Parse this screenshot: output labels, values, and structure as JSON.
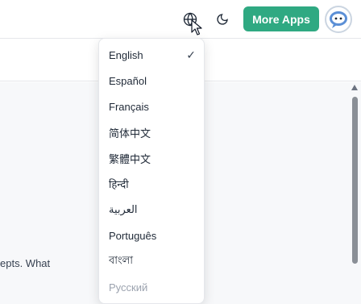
{
  "header": {
    "more_apps_label": "More Apps"
  },
  "language_menu": {
    "selected": "English",
    "items": [
      {
        "label": "English",
        "selected": true
      },
      {
        "label": "Español"
      },
      {
        "label": "Français"
      },
      {
        "label": "简体中文"
      },
      {
        "label": "繁體中文"
      },
      {
        "label": "हिन्दी"
      },
      {
        "label": "العربية"
      },
      {
        "label": "Português"
      },
      {
        "label": "বাংলা"
      },
      {
        "label": "Русский"
      }
    ],
    "check_mark": "✓"
  },
  "main": {
    "partial_text": "epts. What"
  },
  "colors": {
    "accent": "#2fa982"
  }
}
